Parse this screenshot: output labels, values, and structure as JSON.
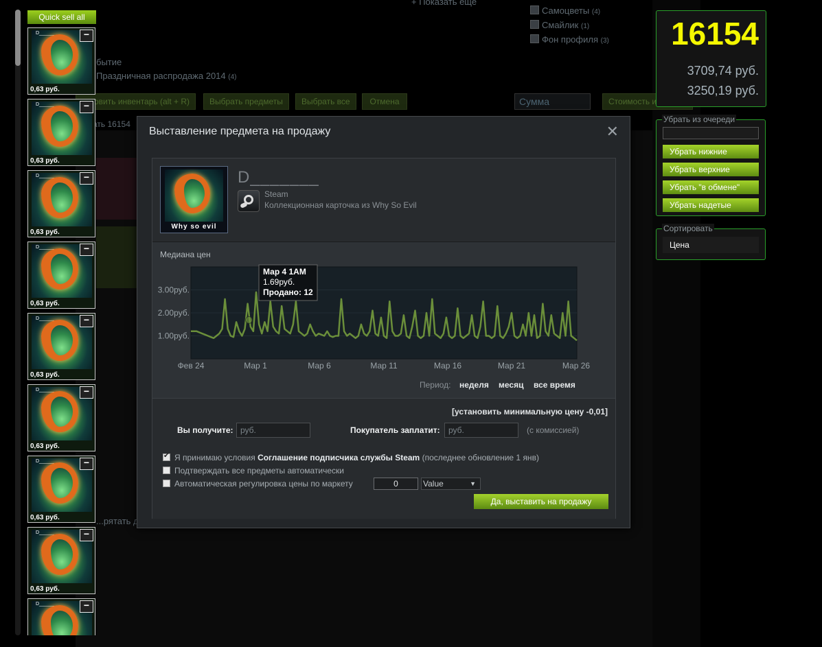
{
  "background": {
    "show_more": "+ Показать еще",
    "filters": [
      {
        "label": "Самоцветы",
        "count": "(4)"
      },
      {
        "label": "Смайлик",
        "count": "(1)"
      },
      {
        "label": "Фон профиля",
        "count": "(3)"
      }
    ],
    "event_label": "бытие",
    "sale_event": "Праздничная распродажа 2014",
    "sale_event_count": "(4)",
    "buttons": {
      "refresh_inventory": "...овить инвентарь (alt + R)",
      "select_items": "Выбрать предметы",
      "select_all": "Выбрать все",
      "cancel": "Отмена",
      "inventory_value": "Стоимость инвентаря"
    },
    "sum_placeholder": "Сумма",
    "sell_count_fragment": "...дать 16154",
    "hide_fragment": "...рятать д"
  },
  "left_column": {
    "quick_sell_label": "Quick sell all",
    "item_name": "D_______",
    "minus": "−",
    "item_price": "0,63 руб."
  },
  "counter": {
    "count": "16154",
    "amount_1": "3709,74 руб.",
    "amount_2": "3250,19 руб."
  },
  "queue": {
    "legend": "Убрать из очереди",
    "buttons": [
      "Убрать нижние",
      "Убрать верхние",
      "Убрать \"в обмене\"",
      "Убрать надетые"
    ]
  },
  "sort": {
    "legend": "Сортировать",
    "value": "Цена"
  },
  "modal": {
    "title": "Выставление предмета на продажу",
    "close": "X",
    "item": {
      "name": "D_______",
      "card_caption": "Why so evil",
      "game": "Steam",
      "type": "Коллекционная карточка из Why So Evil"
    },
    "chart_title": "Медиана цен",
    "period_label": "Период:",
    "periods": [
      "неделя",
      "месяц",
      "все время"
    ],
    "form": {
      "min_price_link": "[установить минимальную цену -0,01]",
      "receive_label": "Вы получите:",
      "receive_placeholder": "руб.",
      "buyer_label": "Покупатель заплатит:",
      "buyer_placeholder": "руб.",
      "with_fee": "(с комиссией)",
      "accept_prefix": "Я принимаю условия",
      "accept_link": "Соглашение подписчика службы Steam",
      "accept_suffix": "(последнее обновление 1 янв)",
      "auto_confirm": "Подтверждать все предметы автоматически",
      "auto_price": "Автоматическая регулировка цены по маркету",
      "auto_price_value": "0",
      "auto_price_mode": "Value",
      "submit": "Да, выставить на продажу"
    }
  },
  "chart_data": {
    "type": "line",
    "title": "Медиана цен",
    "x_ticks": [
      "Фев 24",
      "Мар 1",
      "Мар 6",
      "Мар 11",
      "Мар 16",
      "Мар 21",
      "Мар 26"
    ],
    "y_ticks": [
      "1.00руб.",
      "2.00руб.",
      "3.00руб."
    ],
    "ylim": [
      0,
      4
    ],
    "series": [
      {
        "values": [
          1.2,
          1.2,
          1.2,
          1.15,
          1.1,
          1.05,
          1.0,
          0.95,
          0.9,
          1.0,
          1.1,
          1.3,
          2.6,
          1.3,
          1.0,
          0.95,
          1.6,
          1.2,
          1.0,
          1.3,
          2.4,
          1.4,
          1.2,
          2.9,
          1.5,
          1.1,
          1.6,
          1.2,
          2.5,
          1.4,
          1.2,
          1.1,
          2.3,
          1.3,
          1.2,
          1.1,
          1.5,
          2.5,
          1.2,
          1.1,
          1.0,
          1.1,
          1.5,
          1.2,
          1.0,
          1.1,
          1.05,
          1.0,
          1.2,
          1.0,
          0.95,
          1.0,
          1.0,
          2.6,
          1.2,
          1.0,
          1.1,
          1.0,
          0.9,
          1.0,
          1.5,
          1.1,
          1.0,
          1.2,
          2.1,
          1.1,
          1.0,
          1.8,
          1.0,
          0.9,
          2.5,
          1.2,
          1.0,
          1.0,
          1.1,
          1.9,
          1.0,
          0.9,
          1.4,
          2.1,
          1.0,
          0.9,
          1.0,
          2.0,
          1.0,
          2.6,
          1.1,
          1.0,
          0.9,
          1.1,
          1.8,
          1.0,
          0.9,
          1.0,
          2.2,
          1.0,
          0.9,
          1.0,
          1.1,
          1.9,
          1.0,
          0.9,
          1.4,
          2.5,
          1.0,
          1.0,
          0.9,
          1.0,
          2.3,
          1.0,
          0.9,
          1.1,
          1.4,
          2.0,
          1.0,
          0.9,
          1.0,
          1.5,
          1.0,
          2.0,
          1.0,
          1.9,
          0.9,
          1.0,
          2.4,
          1.2,
          1.0,
          1.9,
          1.1,
          1.0,
          0.9,
          2.0,
          1.0,
          2.5,
          1.0,
          0.9,
          0.8
        ]
      }
    ],
    "tooltip": {
      "date": "Мар 4 1AM",
      "price": "1.69руб.",
      "sold": "Продано: 12"
    }
  }
}
